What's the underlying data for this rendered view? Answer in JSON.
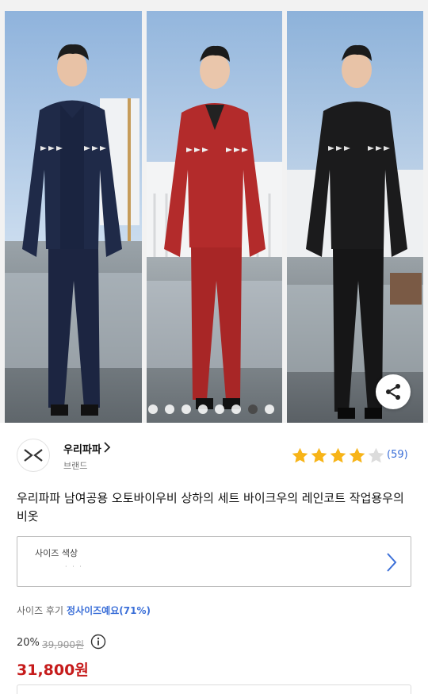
{
  "brand": {
    "name": "우리파파",
    "sub_label": "브랜드"
  },
  "rating": {
    "stars": 4,
    "max_stars": 5,
    "review_count": "(59)",
    "star_color": "#f7b418",
    "empty_color": "#dcdcdc"
  },
  "product": {
    "title": "우리파파 남여공용 오토바이우비 상하의 세트 바이크우의 레인코트 작업용우의 비옷"
  },
  "option": {
    "label": "사이즈 색상",
    "value": "· · ·"
  },
  "size_feedback": {
    "label": "사이즈 후기",
    "value": "정사이즈예요(71%)"
  },
  "price": {
    "discount": "20%",
    "original": "39,900원",
    "final": "31,800원",
    "accent": "#c61b1b"
  },
  "gallery": {
    "slides": 8,
    "active_slide": 6,
    "panels": [
      "navy-raincoat-model",
      "red-raincoat-model",
      "black-raincoat-model"
    ]
  },
  "icons": [
    "share-icon",
    "chevron-right-icon",
    "star-icon",
    "info-icon",
    "brand-logo-icon"
  ]
}
